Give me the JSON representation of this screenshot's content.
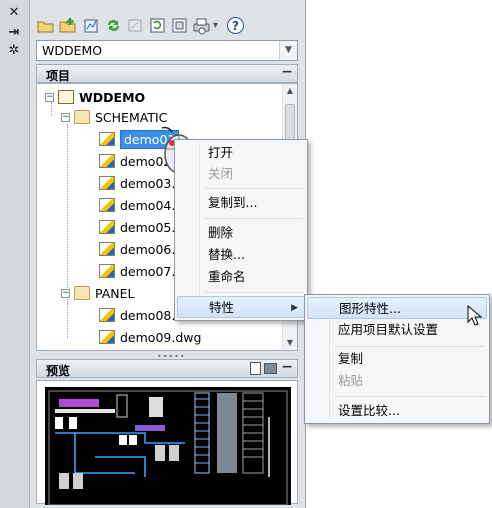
{
  "strip": {
    "close_glyph": "✕",
    "autohide_glyph": "⇥",
    "props_glyph": "✲"
  },
  "toolbar": {
    "icons": [
      "open-project-icon",
      "new-project-icon",
      "new-drawing-icon",
      "refresh-icon",
      "update-icon",
      "project-properties-icon",
      "drawing-list-icon",
      "plot-icon",
      "help-icon"
    ],
    "dropdown_glyph": "▾",
    "help_glyph": "?"
  },
  "project_combo": {
    "value": "WDDEMO"
  },
  "projects_panel": {
    "title": "项目",
    "minimize_glyph": "−",
    "tree": {
      "root": "WDDEMO",
      "folders": [
        {
          "name": "SCHEMATIC",
          "drawings": [
            "demo01",
            "demo02",
            "demo03.d",
            "demo04.d",
            "demo05.d",
            "demo06.d",
            "demo07.d"
          ]
        },
        {
          "name": "PANEL",
          "drawings": [
            "demo08.d",
            "demo09.dwg"
          ]
        }
      ],
      "selected": "demo01"
    }
  },
  "preview_panel": {
    "title": "预览",
    "minimize_glyph": "−"
  },
  "context_menu": {
    "items": [
      {
        "label": "打开",
        "enabled": true
      },
      {
        "label": "关闭",
        "enabled": false
      },
      {
        "label": "复制到...",
        "enabled": true
      },
      {
        "label": "删除",
        "enabled": true
      },
      {
        "label": "替换...",
        "enabled": true
      },
      {
        "label": "重命名",
        "enabled": true
      },
      {
        "label": "特性",
        "enabled": true,
        "submenu_glyph": "▶"
      }
    ]
  },
  "submenu": {
    "items": [
      {
        "label": "图形特性...",
        "enabled": true
      },
      {
        "label": "应用项目默认设置",
        "enabled": true
      },
      {
        "label": "复制",
        "enabled": true
      },
      {
        "label": "粘贴",
        "enabled": false
      },
      {
        "label": "设置比较...",
        "enabled": true
      }
    ]
  },
  "colors": {
    "selection": "#3a8ee6",
    "highlight": "#d2e3f7",
    "frame": "#dfe3e8"
  }
}
